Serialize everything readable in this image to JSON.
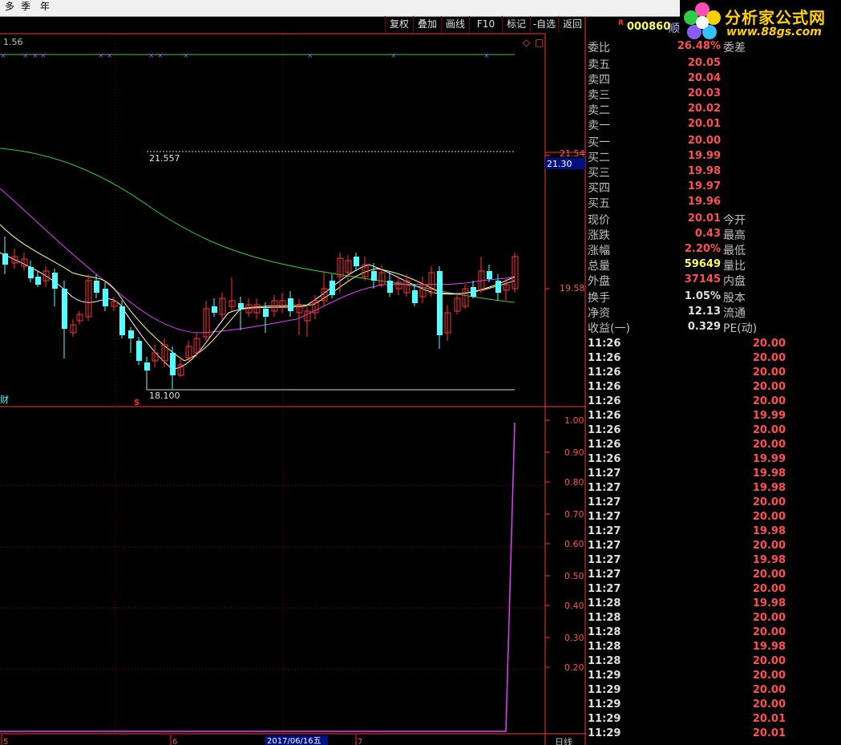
{
  "period_tabs": [
    "多",
    "季",
    "年"
  ],
  "toolbar": [
    "复权",
    "叠加",
    "画线",
    "F10",
    "标记",
    "-自选",
    "返回"
  ],
  "stock": {
    "badge": "R",
    "code": "000860",
    "name": "顺"
  },
  "logo": {
    "text": "分析家公式网",
    "url": "www.88gs.com"
  },
  "main_chart": {
    "top_left_value": "1.56",
    "high_label": "21.557",
    "low_label": "18.100",
    "left_marker": "财",
    "right_axis": {
      "top_value": "21.54",
      "current_price_box": "21.30",
      "bottom_value": "19.58"
    }
  },
  "indicator": {
    "y_ticks": [
      "1.00",
      "0.90",
      "0.80",
      "0.70",
      "0.60",
      "0.50",
      "0.40",
      "0.30",
      "0.20"
    ],
    "bottom_axis": {
      "date_box": "2017/06/16五",
      "month_marks": [
        "5",
        "6",
        "7"
      ],
      "period_label": "日线"
    }
  },
  "quote": {
    "weibi": {
      "label": "委比",
      "value": "26.48%",
      "label2": "委差"
    },
    "asks": [
      {
        "label": "卖五",
        "price": "20.05"
      },
      {
        "label": "卖四",
        "price": "20.04"
      },
      {
        "label": "卖三",
        "price": "20.03"
      },
      {
        "label": "卖二",
        "price": "20.02"
      },
      {
        "label": "卖一",
        "price": "20.01"
      }
    ],
    "bids": [
      {
        "label": "买一",
        "price": "20.00"
      },
      {
        "label": "买二",
        "price": "19.99"
      },
      {
        "label": "买三",
        "price": "19.98"
      },
      {
        "label": "买四",
        "price": "19.97"
      },
      {
        "label": "买五",
        "price": "19.96"
      }
    ],
    "stats": [
      {
        "label": "现价",
        "value": "20.01",
        "label2": "今开"
      },
      {
        "label": "涨跌",
        "value": "0.43",
        "label2": "最高"
      },
      {
        "label": "涨幅",
        "value": "2.20%",
        "label2": "最低"
      },
      {
        "label": "总量",
        "value": "59649",
        "label2": "量比"
      },
      {
        "label": "外盘",
        "value": "37145",
        "label2": "内盘"
      }
    ],
    "fundamentals": [
      {
        "label": "换手",
        "value": "1.05%",
        "label2": "股本"
      },
      {
        "label": "净资",
        "value": "12.13",
        "label2": "流通"
      },
      {
        "label": "收益(一)",
        "value": "0.329",
        "label2": "PE(动)"
      }
    ]
  },
  "ticks": [
    {
      "time": "11:26",
      "price": "20.00"
    },
    {
      "time": "11:26",
      "price": "20.00"
    },
    {
      "time": "11:26",
      "price": "20.00"
    },
    {
      "time": "11:26",
      "price": "20.00"
    },
    {
      "time": "11:26",
      "price": "20.00"
    },
    {
      "time": "11:26",
      "price": "19.99"
    },
    {
      "time": "11:26",
      "price": "20.00"
    },
    {
      "time": "11:26",
      "price": "20.00"
    },
    {
      "time": "11:26",
      "price": "19.99"
    },
    {
      "time": "11:27",
      "price": "19.98"
    },
    {
      "time": "11:27",
      "price": "19.98"
    },
    {
      "time": "11:27",
      "price": "20.00"
    },
    {
      "time": "11:27",
      "price": "20.00"
    },
    {
      "time": "11:27",
      "price": "19.98"
    },
    {
      "time": "11:27",
      "price": "20.00"
    },
    {
      "time": "11:27",
      "price": "19.98"
    },
    {
      "time": "11:27",
      "price": "20.00"
    },
    {
      "time": "11:27",
      "price": "20.00"
    },
    {
      "time": "11:28",
      "price": "19.98"
    },
    {
      "time": "11:28",
      "price": "20.00"
    },
    {
      "time": "11:28",
      "price": "20.00"
    },
    {
      "time": "11:28",
      "price": "19.98"
    },
    {
      "time": "11:28",
      "price": "20.00"
    },
    {
      "time": "11:29",
      "price": "20.00"
    },
    {
      "time": "11:29",
      "price": "20.00"
    },
    {
      "time": "11:29",
      "price": "20.00"
    },
    {
      "time": "11:29",
      "price": "20.01"
    },
    {
      "time": "11:29",
      "price": "20.01"
    }
  ],
  "chart_data": {
    "type": "candlestick",
    "price_scale_labels": {
      "top": 21.54,
      "bottom": 19.58
    },
    "visible_extremes": {
      "high": 21.557,
      "low": 18.1
    },
    "current_price": 21.3,
    "indicator_range": [
      0.2,
      1.0
    ],
    "indicator_last_value": 1.0
  }
}
